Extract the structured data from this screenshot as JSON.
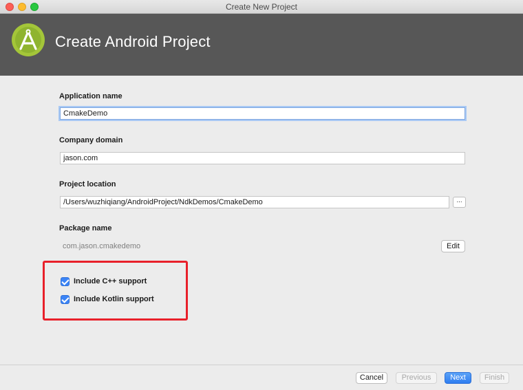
{
  "window": {
    "title": "Create New Project"
  },
  "header": {
    "title": "Create Android Project"
  },
  "form": {
    "application_name": {
      "label": "Application name",
      "value": "CmakeDemo"
    },
    "company_domain": {
      "label": "Company domain",
      "value": "jason.com"
    },
    "project_location": {
      "label": "Project location",
      "value": "/Users/wuzhiqiang/AndroidProject/NdkDemos/CmakeDemo",
      "browse_label": "..."
    },
    "package_name": {
      "label": "Package name",
      "value": "com.jason.cmakedemo",
      "edit_label": "Edit"
    },
    "options": [
      {
        "label": "Include C++ support",
        "checked": true
      },
      {
        "label": "Include Kotlin support",
        "checked": true
      }
    ]
  },
  "footer": {
    "cancel_label": "Cancel",
    "previous_label": "Previous",
    "next_label": "Next",
    "finish_label": "Finish"
  },
  "colors": {
    "header_bg": "#575757",
    "accent": "#3b84f6",
    "highlight": "#e8202a",
    "android_green": "#a4c639"
  }
}
